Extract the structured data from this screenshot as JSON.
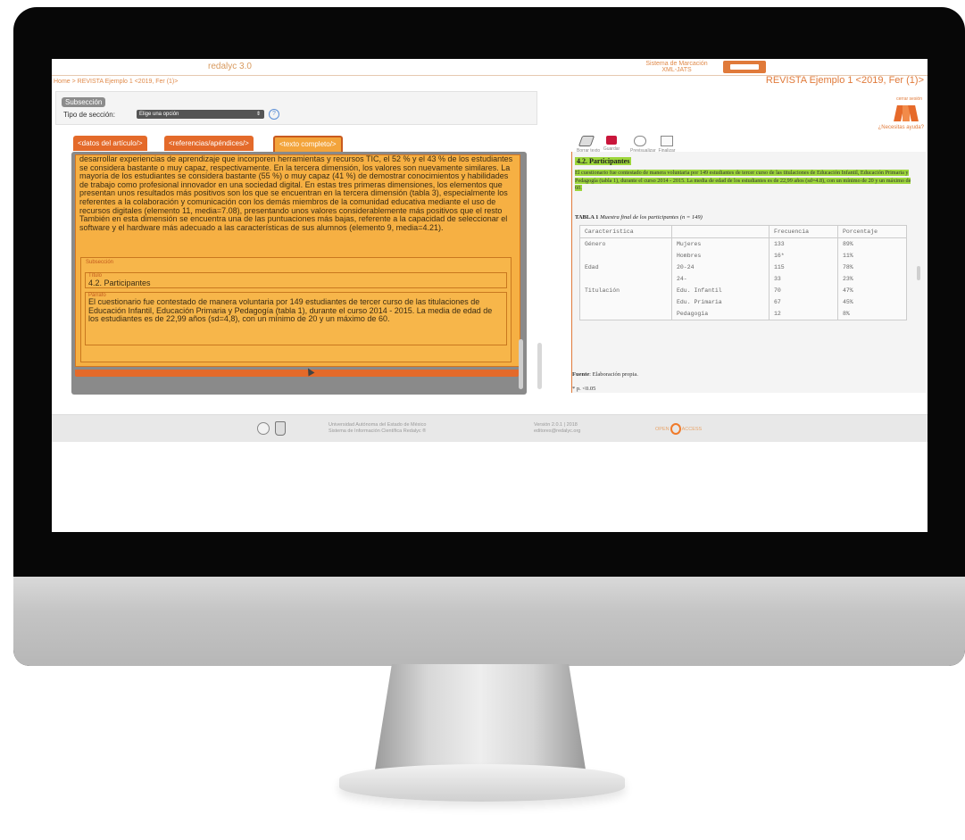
{
  "app": {
    "logo": "redalyc 3.0",
    "system_name_line1": "Sistema de Marcación",
    "system_name_line2": "XML-JATS",
    "breadcrumb": "Home > REVISTA Ejemplo 1 <2019, Fer (1)>",
    "journal_title": "REVISTA Ejemplo 1 <2019, Fer (1)>",
    "close_session": "cerrar sesión",
    "help_text": "¿Necesitas ayuda?"
  },
  "subsection_panel": {
    "tab": "Subsección",
    "type_label": "Tipo de sección:",
    "type_value": "Elige una opción"
  },
  "tabs": [
    {
      "label": "<datos del artículo/>"
    },
    {
      "label": "<referencias/apéndices/>"
    },
    {
      "label": "<texto completo/>"
    }
  ],
  "editor": {
    "paragraph": "desarrollar experiencias de aprendizaje que incorporen herramientas y recursos TIC, el 52 % y el 43 % de los estudiantes se considera bastante o muy capaz, respectivamente. En la tercera dimensión, los valores son nuevamente similares. La mayoría de los estudiantes se considera bastante (55 %) o muy capaz (41 %) de demostrar conocimientos y habilidades de trabajo como profesional innovador en una sociedad digital. En estas tres primeras dimensiones, los elementos que presentan unos resultados más positivos son los que se encuentran en la tercera dimensión (tabla 3), especialmente los referentes a la colaboración y comunicación con los demás miembros de la comunidad educativa mediante el uso de recursos digitales (elemento 11, media=7.08), presentando unos valores considerablemente más positivos que el resto También en esta dimensión se encuentra una de las puntuaciones más bajas, referente a la capacidad de seleccionar el software y el hardware más adecuado a las características de sus alumnos (elemento 9, media=4.21).",
    "subsection_label": "Subsección",
    "title_label": "Título",
    "title_value": "4.2. Participantes",
    "paragraph_label": "Párrafo",
    "paragraph_value": "El cuestionario fue contestado de manera voluntaria por 149 estudiantes de tercer curso de las titulaciones de Educación Infantil, Educación Primaria y Pedagogía (tabla 1), durante el curso 2014 - 2015. La media de edad de los estudiantes es de 22,99 años (sd=4,8), con un mínimo de 20 y un máximo de 60."
  },
  "toolbar": [
    {
      "label": "Borrar texto",
      "icon": "eraser-icon"
    },
    {
      "label": "Guardar",
      "icon": "save-icon"
    },
    {
      "label": "Previsualizar",
      "icon": "cloud-icon"
    },
    {
      "label": "Finalizar",
      "icon": "finish-icon"
    }
  ],
  "preview": {
    "heading": "4.2. Participantes",
    "paragraph": "El cuestionario fue contestado de manera voluntaria por 149 estudiantes de tercer curso de las titulaciones de Educación Infantil, Educación Primaria y Pedagogía (tabla 1), durante el curso 2014 - 2015. La media de edad de los estudiantes es de 22,99 años (sd=4.8), con un mínimo de 20 y un máximo de 60.",
    "table_label": "TABLA 1",
    "table_caption": "Muestra final de los participantes (n = 149)",
    "table_headers": [
      "Característica",
      "",
      "Frecuencia",
      "Porcentaje"
    ],
    "table_rows": [
      [
        "Género",
        "Mujeres",
        "133",
        "89%"
      ],
      [
        "",
        "Hombres",
        "16*",
        "11%"
      ],
      [
        "Edad",
        "20-24",
        "115",
        "78%"
      ],
      [
        "",
        "24-",
        "33",
        "23%"
      ],
      [
        "Titulación",
        "Edu. Infantil",
        "70",
        "47%"
      ],
      [
        "",
        "Edu. Primaria",
        "67",
        "45%"
      ],
      [
        "",
        "Pedagogía",
        "12",
        "8%"
      ]
    ],
    "source_label": "Fuente",
    "source_value": ": Elaboración propia.",
    "note": "* p. <0.05"
  },
  "footer": {
    "university_line1": "Universidad Autónoma del Estado de México",
    "university_line2": "Sistema de Información Científica Redalyc ®",
    "version_line1": "Versión 2.0.1 | 2018",
    "version_line2": "editores@redalyc.org",
    "open_left": "OPEN",
    "open_right": "ACCESS"
  },
  "colors": {
    "accent": "#e46a2a",
    "editor_bg": "#f6b043",
    "highlight": "#9dd63b"
  }
}
